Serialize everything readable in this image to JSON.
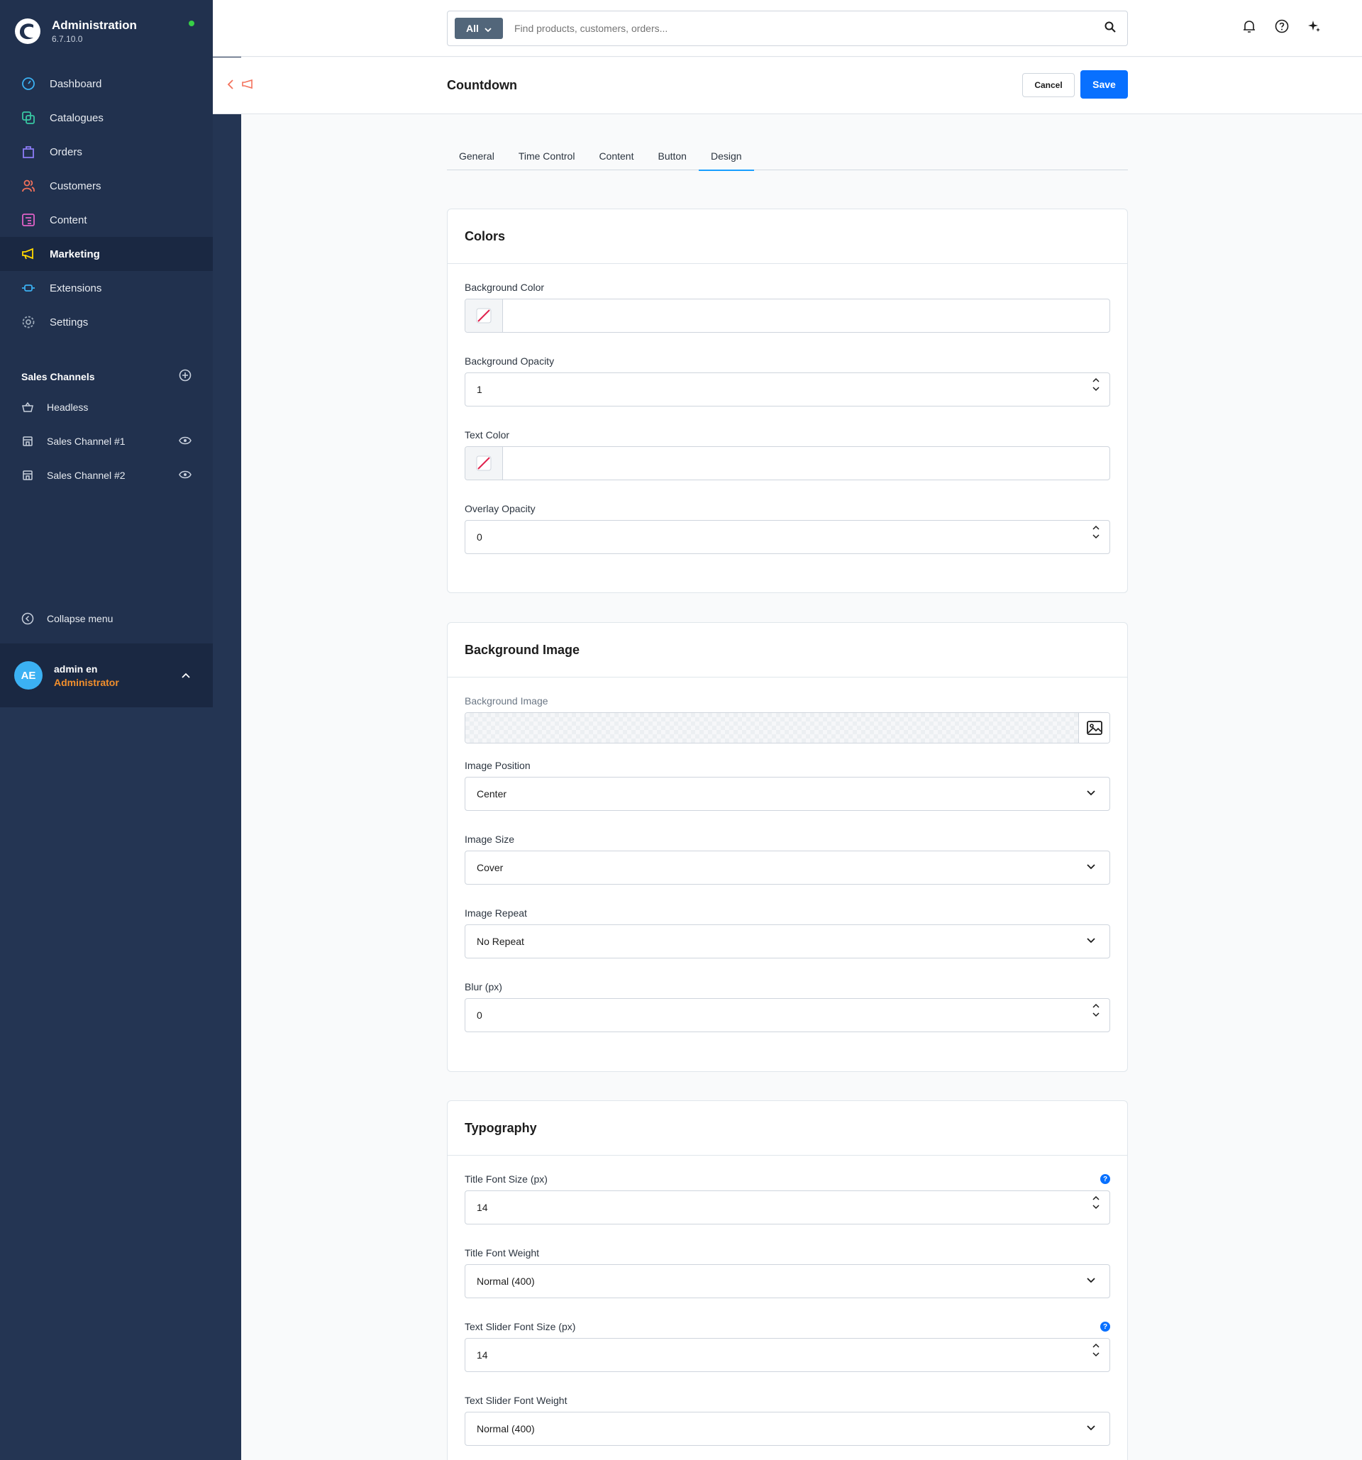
{
  "brand": {
    "title": "Administration",
    "version": "6.7.10.0"
  },
  "nav": [
    {
      "label": "Dashboard",
      "icon": "dashboard-icon"
    },
    {
      "label": "Catalogues",
      "icon": "catalogue-icon"
    },
    {
      "label": "Orders",
      "icon": "orders-icon"
    },
    {
      "label": "Customers",
      "icon": "customers-icon"
    },
    {
      "label": "Content",
      "icon": "content-icon"
    },
    {
      "label": "Marketing",
      "icon": "megaphone-icon",
      "active": true
    },
    {
      "label": "Extensions",
      "icon": "plug-icon"
    },
    {
      "label": "Settings",
      "icon": "gear-icon"
    }
  ],
  "sales_channels": {
    "title": "Sales Channels",
    "items": [
      {
        "label": "Headless"
      },
      {
        "label": "Sales Channel #1"
      },
      {
        "label": "Sales Channel #2"
      }
    ]
  },
  "collapse_label": "Collapse menu",
  "user": {
    "initials": "AE",
    "name": "admin en",
    "role": "Administrator"
  },
  "search": {
    "type": "All",
    "placeholder": "Find products, customers, orders..."
  },
  "header": {
    "title": "Countdown",
    "cancel": "Cancel",
    "save": "Save"
  },
  "tabs": [
    {
      "label": "General"
    },
    {
      "label": "Time Control"
    },
    {
      "label": "Content"
    },
    {
      "label": "Button"
    },
    {
      "label": "Design",
      "active": true
    }
  ],
  "colors_card": {
    "title": "Colors",
    "background_color": {
      "label": "Background Color",
      "value": ""
    },
    "background_opacity": {
      "label": "Background Opacity",
      "value": "1"
    },
    "text_color": {
      "label": "Text Color",
      "value": ""
    },
    "overlay_opacity": {
      "label": "Overlay Opacity",
      "value": "0"
    }
  },
  "bg_image_card": {
    "title": "Background Image",
    "background_image": {
      "label": "Background Image"
    },
    "image_position": {
      "label": "Image Position",
      "value": "Center"
    },
    "image_size": {
      "label": "Image Size",
      "value": "Cover"
    },
    "image_repeat": {
      "label": "Image Repeat",
      "value": "No Repeat"
    },
    "blur": {
      "label": "Blur (px)",
      "value": "0"
    }
  },
  "typography_card": {
    "title": "Typography",
    "title_font_size": {
      "label": "Title Font Size (px)",
      "value": "14"
    },
    "title_font_weight": {
      "label": "Title Font Weight",
      "value": "Normal (400)"
    },
    "slider_font_size": {
      "label": "Text Slider Font Size (px)",
      "value": "14"
    },
    "slider_font_weight": {
      "label": "Text Slider Font Weight",
      "value": "Normal (400)"
    }
  },
  "info_glyph": "?",
  "colors": {
    "sidebar": "#21314e",
    "accent": "#0870ff",
    "tab_active": "#189eff",
    "role": "#f28f2c",
    "online": "#37d046"
  }
}
